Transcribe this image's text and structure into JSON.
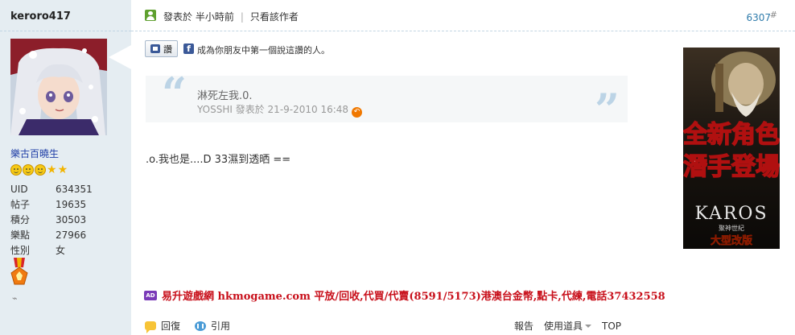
{
  "user": {
    "name": "keroro417",
    "group": "樂古百曉生",
    "stats": [
      {
        "label": "UID",
        "value": "634351"
      },
      {
        "label": "帖子",
        "value": "19635"
      },
      {
        "label": "積分",
        "value": "30503"
      },
      {
        "label": "樂點",
        "value": "27966"
      },
      {
        "label": "性別",
        "value": "女"
      }
    ]
  },
  "post": {
    "posted_time": "發表於 半小時前",
    "author_only": "只看該作者",
    "number": "6307",
    "hash": "#",
    "like_label": "讚",
    "fb_text": "成為你朋友中第一個說這讚的人。",
    "quote_text": "淋死左我.0.",
    "quote_author": "YOSSHI 發表於 21-9-2010 16:48",
    "message": ".o.我也是....D 33濕到透晒 ==",
    "signature": "易升遊戲網 hkmogame.com 平放/回收,代買/代賣(8591/5173)港澳台金幣,點卡,代練,電話37432558"
  },
  "ad": {
    "line1": "全新角色",
    "line2": "潛手登場",
    "brand": "KAROS",
    "brand_sub": "聚神世紀",
    "banner": "大型改版"
  },
  "footer": {
    "reply": "回復",
    "quote": "引用",
    "report": "報告",
    "tools": "使用道具",
    "top": "TOP"
  },
  "colors": {
    "sidebar_bg": "#e5edf2",
    "link_blue": "#2e7bab",
    "signature_red": "#c8101b",
    "quote_bg": "#f5f7f8"
  }
}
